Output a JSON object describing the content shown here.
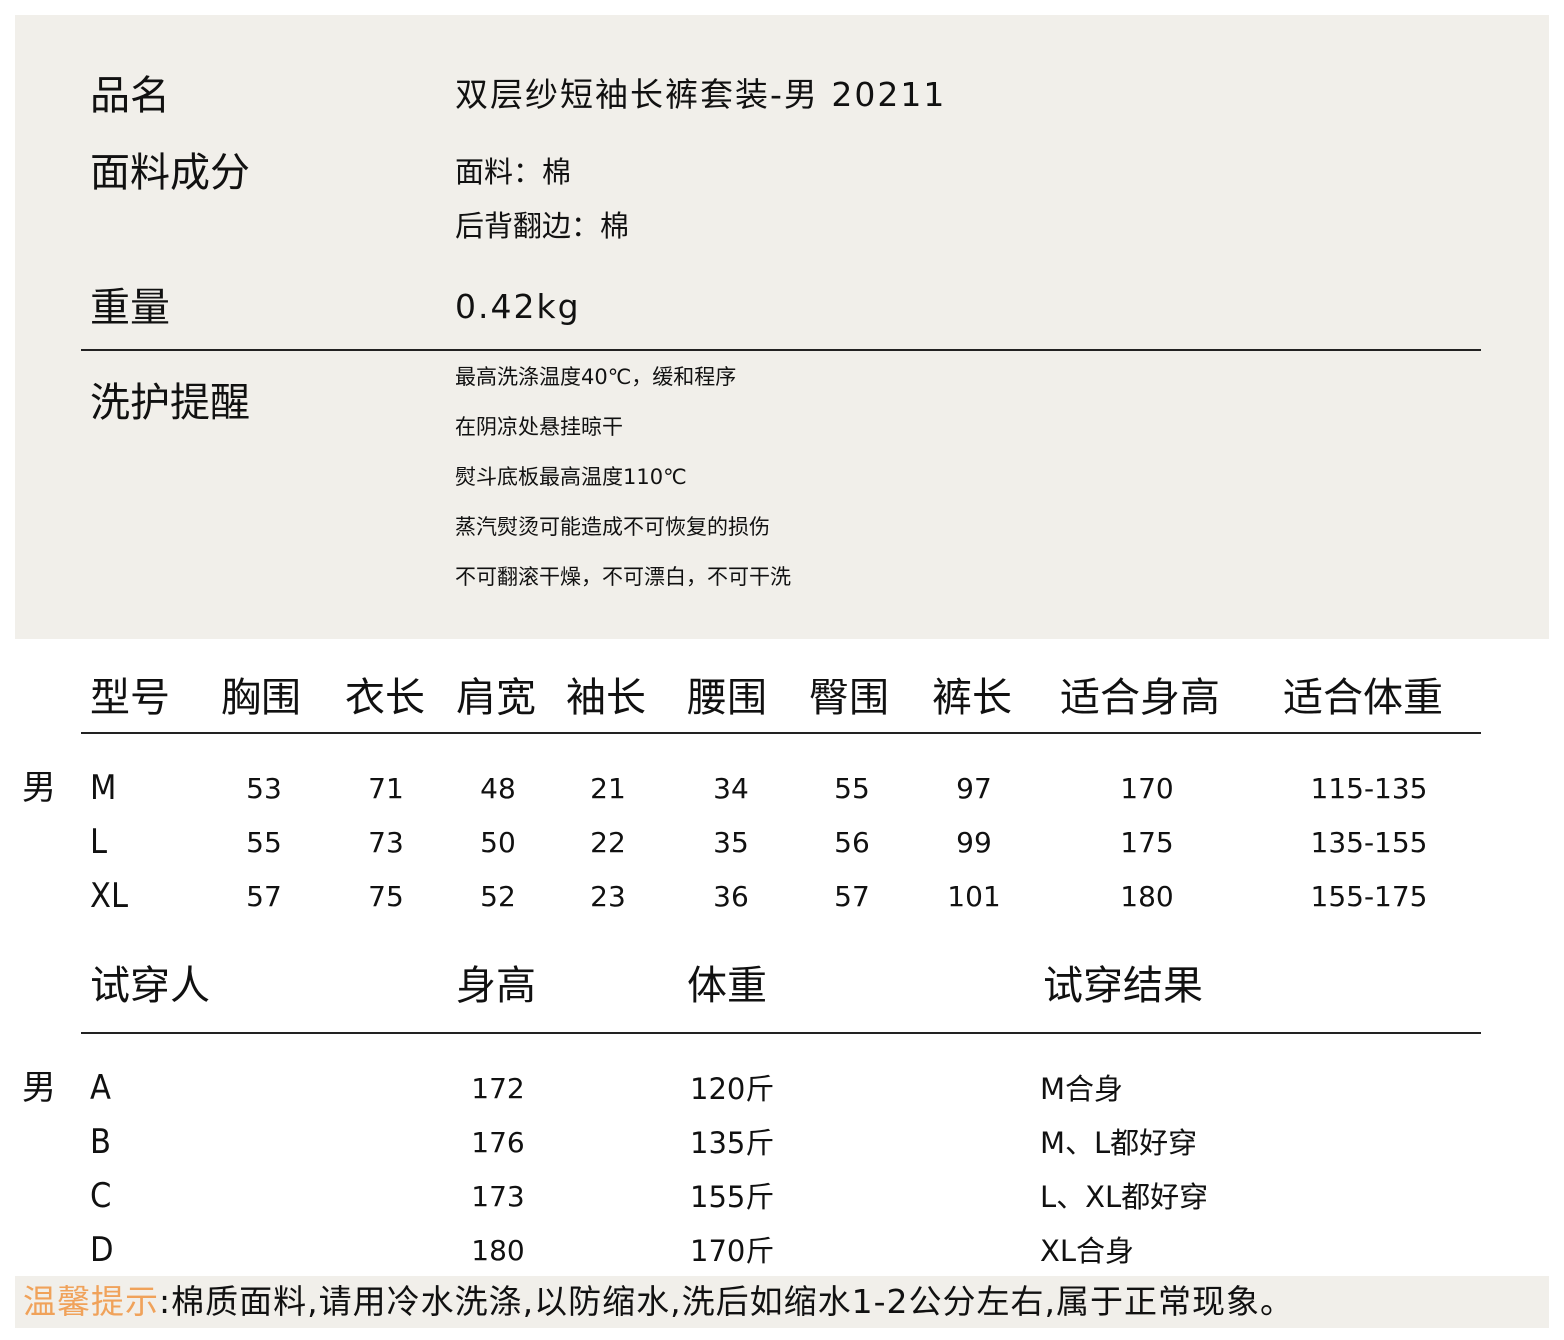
{
  "product": {
    "name_label": "品名",
    "name_value": "双层纱短袖长裤套装-男 20211",
    "fabric_label": "面料成分",
    "fabric_values": [
      "面料：棉",
      "后背翻边：棉"
    ],
    "weight_label": "重量",
    "weight_value": "0.42kg",
    "care_label": "洗护提醒",
    "care_items": [
      "最高洗涤温度40℃，缓和程序",
      "在阴凉处悬挂晾干",
      "熨斗底板最高温度110℃",
      "蒸汽熨烫可能造成不可恢复的损伤",
      "不可翻滚干燥，不可漂白，不可干洗"
    ]
  },
  "size_table": {
    "headers": [
      "型号",
      "胸围",
      "衣长",
      "肩宽",
      "袖长",
      "腰围",
      "臀围",
      "裤长",
      "适合身高",
      "适合体重"
    ],
    "gender": "男",
    "rows": [
      {
        "size": "M",
        "values": [
          "53",
          "71",
          "48",
          "21",
          "34",
          "55",
          "97",
          "170",
          "115-135"
        ]
      },
      {
        "size": "L",
        "values": [
          "55",
          "73",
          "50",
          "22",
          "35",
          "56",
          "99",
          "175",
          "135-155"
        ]
      },
      {
        "size": "XL",
        "values": [
          "57",
          "75",
          "52",
          "23",
          "36",
          "57",
          "101",
          "180",
          "155-175"
        ]
      }
    ]
  },
  "trial_table": {
    "headers": [
      "试穿人",
      "身高",
      "体重",
      "试穿结果"
    ],
    "gender": "男",
    "rows": [
      {
        "person": "A",
        "height": "172",
        "weight": "120斤",
        "result": "M合身"
      },
      {
        "person": "B",
        "height": "176",
        "weight": "135斤",
        "result": "M、L都好穿"
      },
      {
        "person": "C",
        "height": "173",
        "weight": "155斤",
        "result": "L、XL都好穿"
      },
      {
        "person": "D",
        "height": "180",
        "weight": "170斤",
        "result": "XL合身"
      }
    ]
  },
  "tip": {
    "label": "温馨提示",
    "text": ":棉质面料,请用冷水洗涤,以防缩水,洗后如缩水1-2公分左右,属于正常现象。",
    "accent_color": "#f0a25a"
  }
}
